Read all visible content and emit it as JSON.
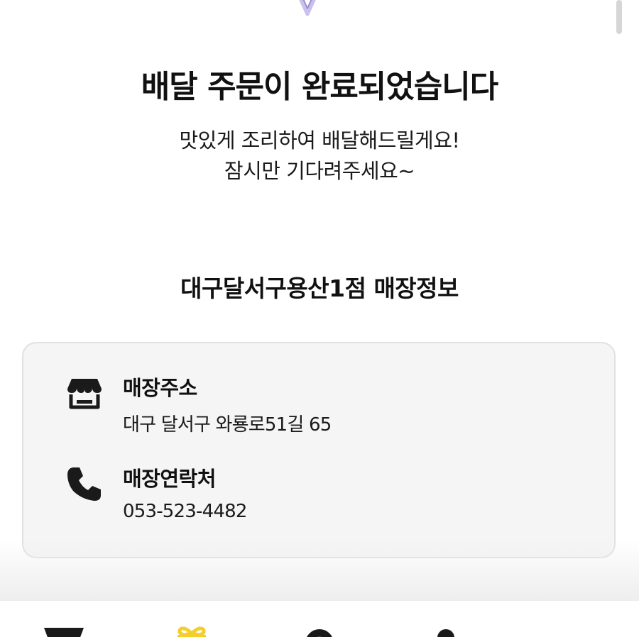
{
  "header": {
    "icon": "check-heart-icon",
    "title": "배달 주문이 완료되었습니다",
    "subtitle_line1": "맛있게 조리하여 배달해드릴게요!",
    "subtitle_line2": "잠시만 기다려주세요~"
  },
  "store": {
    "heading": "대구달서구용산1점 매장정보",
    "address_label": "매장주소",
    "address_value": "대구 달서구 와룡로51길 65",
    "address_icon": "store-icon",
    "phone_label": "매장연락처",
    "phone_value": "053-523-4482",
    "phone_icon": "phone-icon"
  },
  "bottom_nav": {
    "items": [
      {
        "icon": "menu-cup-icon"
      },
      {
        "icon": "gift-icon"
      },
      {
        "icon": "location-pin-icon"
      },
      {
        "icon": "user-icon"
      }
    ]
  },
  "colors": {
    "accent": "#9b8cd6",
    "gift_yellow": "#f2cf2a",
    "icon_dark": "#1a1a1a",
    "card_bg": "#f5f5f5",
    "card_border": "#e1e1e1"
  }
}
